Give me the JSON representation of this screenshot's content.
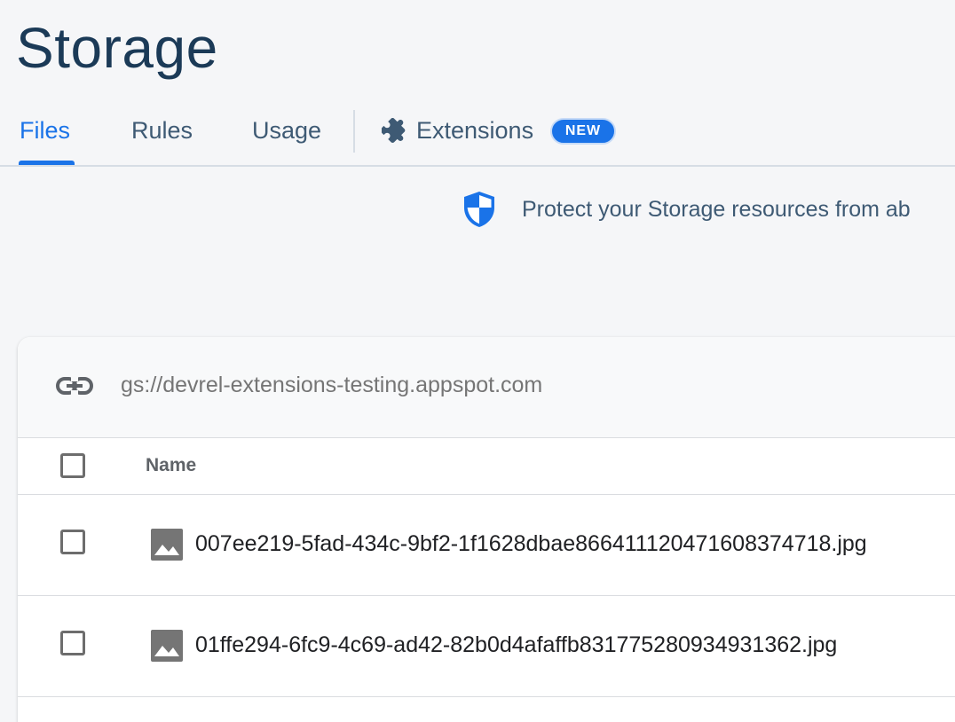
{
  "page": {
    "title": "Storage"
  },
  "tabs": [
    {
      "label": "Files",
      "active": true
    },
    {
      "label": "Rules",
      "active": false
    },
    {
      "label": "Usage",
      "active": false
    },
    {
      "label": "Extensions",
      "active": false,
      "badge": "NEW",
      "icon": "puzzle-icon"
    }
  ],
  "notice": {
    "icon": "shield-icon",
    "text": "Protect your Storage resources from ab"
  },
  "bucket": {
    "icon": "link-icon",
    "path": "gs://devrel-extensions-testing.appspot.com"
  },
  "table": {
    "columns": [
      "Name"
    ],
    "rows": [
      {
        "name": "007ee219-5fad-434c-9bf2-1f1628dbae866411120471608374718.jpg",
        "icon": "image-file-icon"
      },
      {
        "name": "01ffe294-6fc9-4c69-ad42-82b0d4afaffb831775280934931362.jpg",
        "icon": "image-file-icon"
      }
    ]
  },
  "colors": {
    "accent": "#1a73e8",
    "title": "#1b3a57",
    "tab_text": "#3e5a74",
    "background": "#f5f6f8"
  }
}
